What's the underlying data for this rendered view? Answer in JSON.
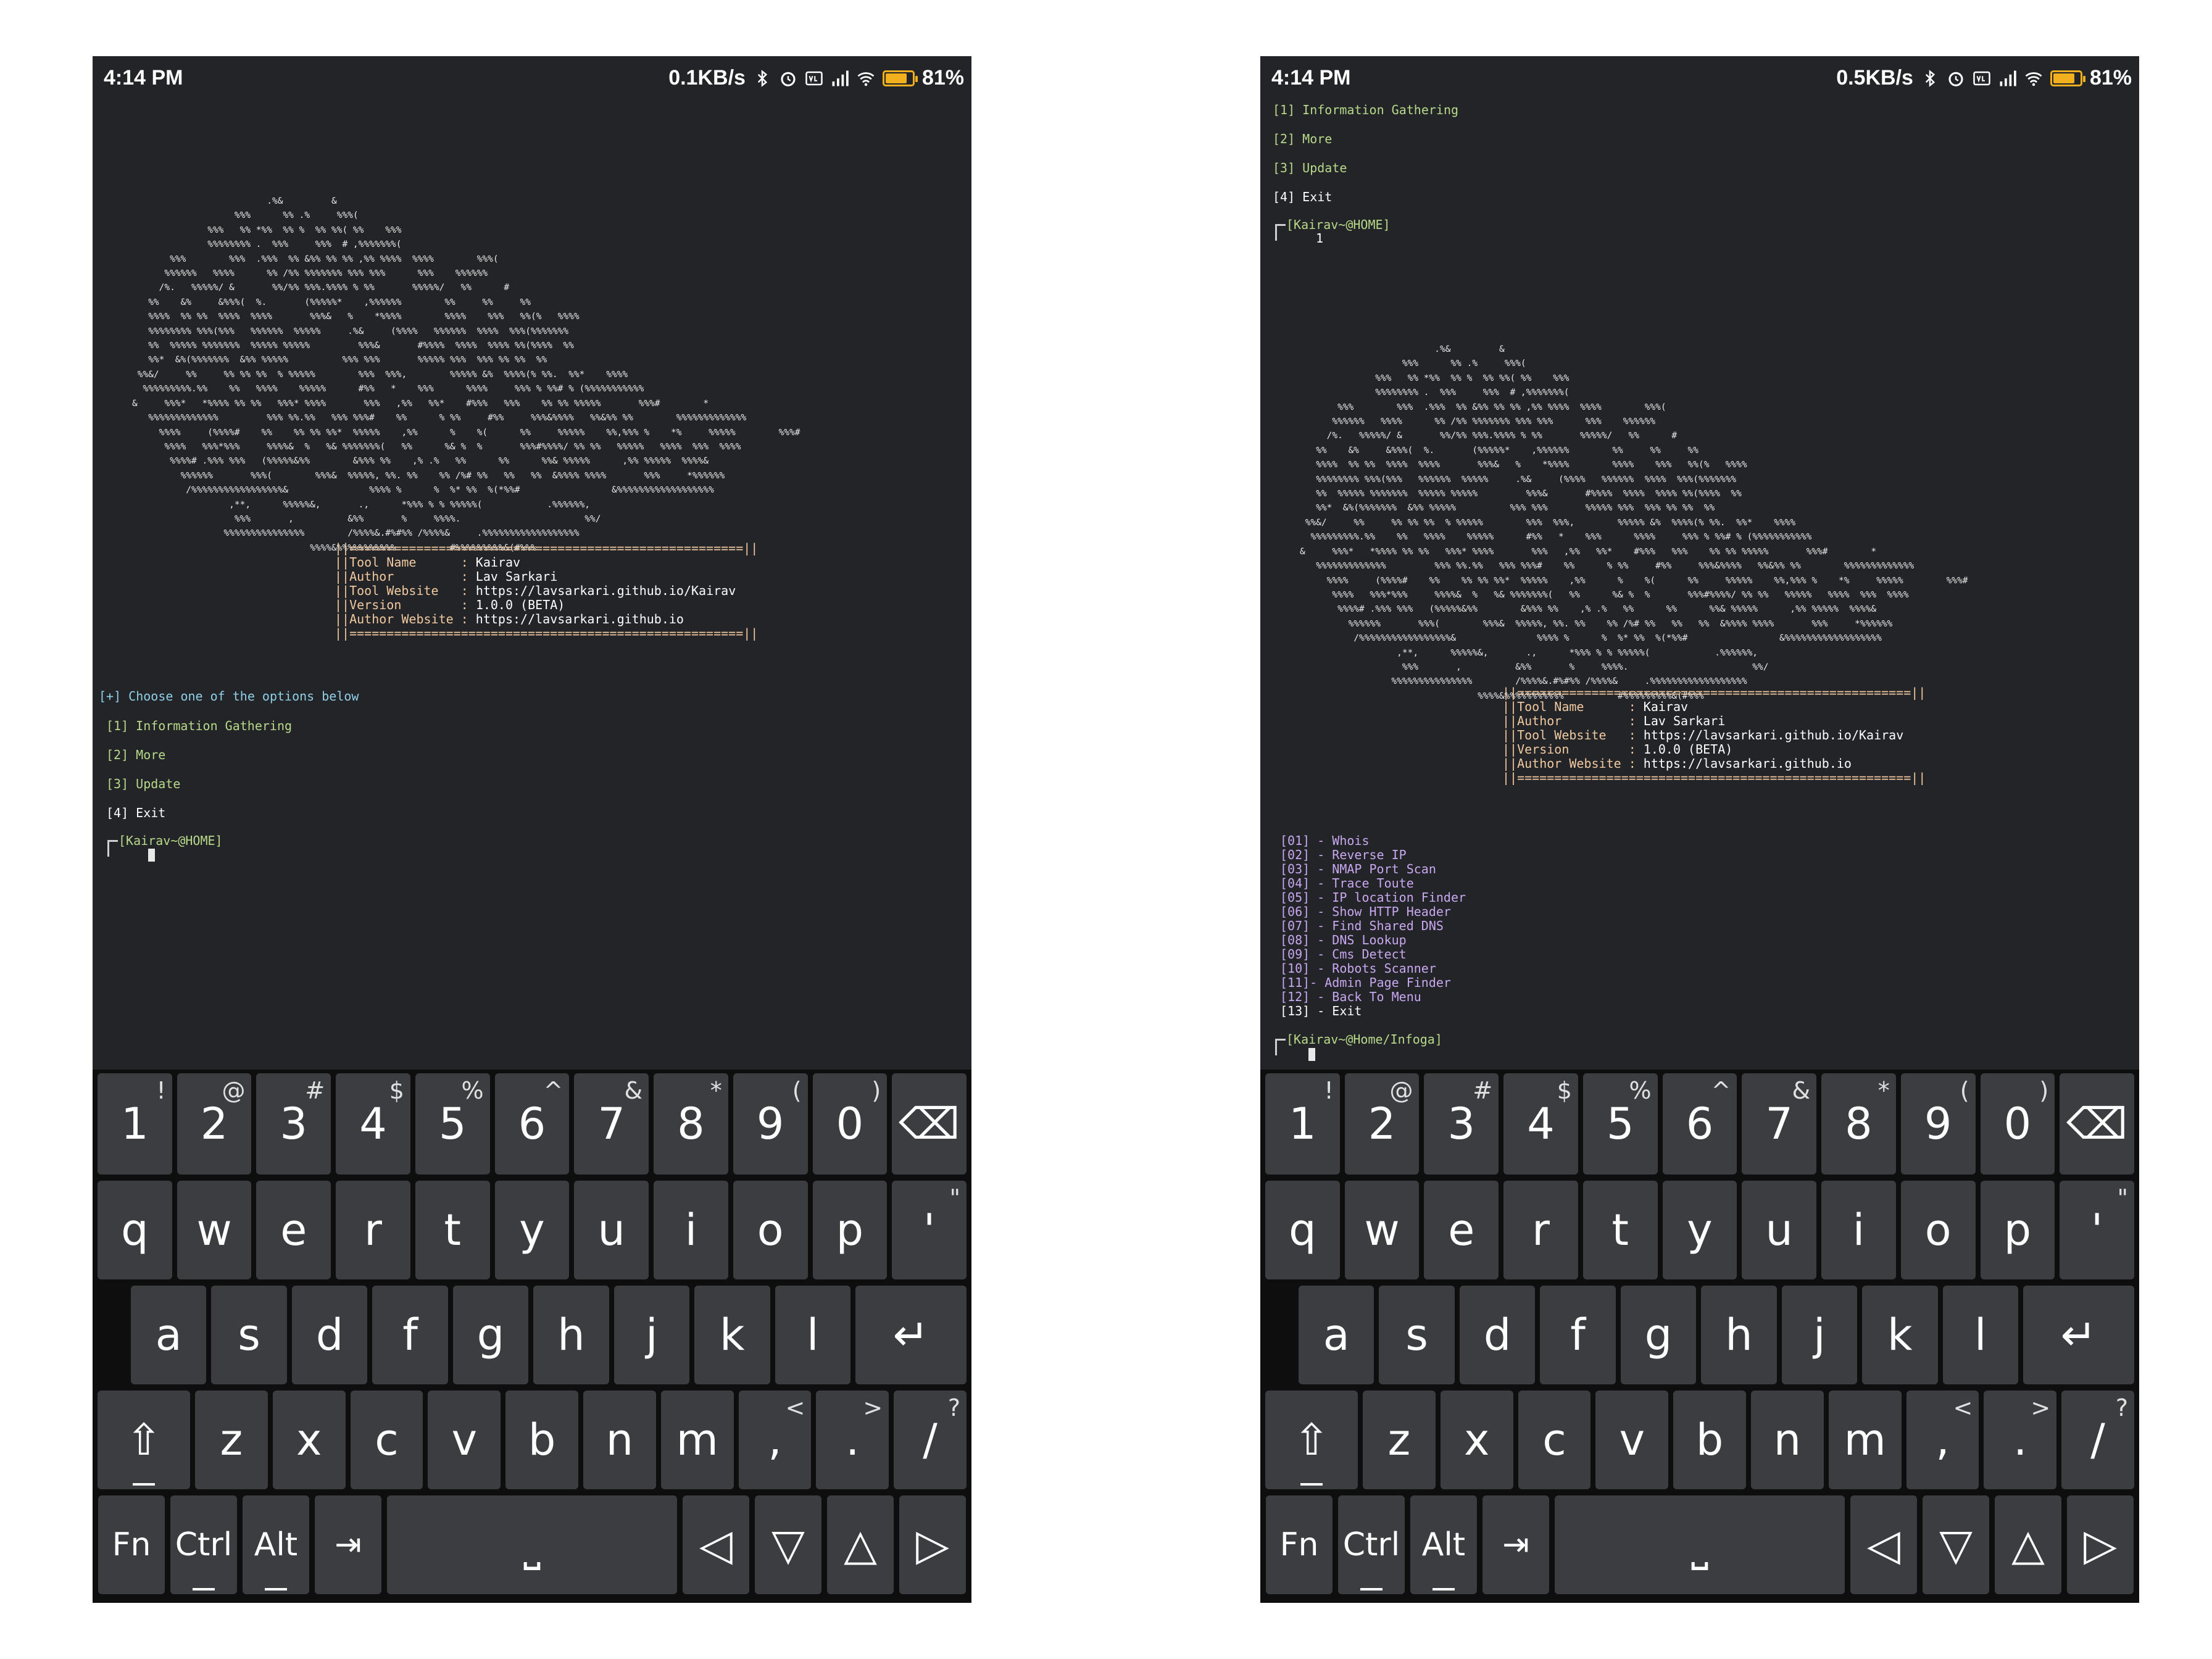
{
  "status_left": {
    "time": "4:14 PM",
    "network_speed": "0.1KB/s",
    "battery": "81%",
    "battery_level": 0.81
  },
  "status_right": {
    "time": "4:14 PM",
    "network_speed": "0.5KB/s",
    "battery": "81%",
    "battery_level": 0.81
  },
  "status_icons": [
    "bluetooth-icon",
    "alarm-icon",
    "volte-icon",
    "signal-icon",
    "wifi-icon",
    "battery-icon"
  ],
  "ascii_banner": "                         .%&         &\n                   %%%      %% .%     %%%(\n              %%%   %% *%%  %% %  %% %%( %%    %%%\n              %%%%%%%% .  %%%     %%%  # ,%%%%%%%(\n       %%%        %%%  .%%%  %% &%% %% %% ,%% %%%%  %%%%        %%%(\n      %%%%%%   %%%%      %% /%% %%%%%%% %%% %%%      %%%    %%%%%%\n     /%.   %%%%%/ &       %%/%% %%%.%%%% % %%       %%%%%/   %%      #\n   %%    &%     &%%%(  %.       (%%%%%*    ,%%%%%%        %%     %%     %%\n   %%%%  %% %%  %%%%  %%%%       %%%&   %    *%%%%        %%%%    %%%   %%(%   %%%%\n   %%%%%%%% %%%(%%%   %%%%%%  %%%%%     .%&     (%%%%   %%%%%%  %%%%  %%%(%%%%%%%\n   %%  %%%%% %%%%%%%  %%%%% %%%%%         %%%&       #%%%%  %%%%  %%%% %%(%%%%  %%\n   %%*  &%(%%%%%%%  &%% %%%%%          %%% %%%       %%%%% %%%  %%% %% %%  %%\n %%&/     %%     %% %% %%  % %%%%%        %%%  %%%,        %%%%% &%  %%%%(% %%.  %%*    %%%%\n  %%%%%%%%%.%%    %%   %%%%    %%%%%      #%%   *    %%%      %%%%     %%% % %%# % (%%%%%%%%%%%\n&     %%%*   *%%%% %% %%   %%%* %%%%       %%%   ,%%   %%*    #%%%   %%%    %% %% %%%%%       %%%#        *\n   %%%%%%%%%%%%%         %%% %%.%%   %%% %%%#    %%      % %%     #%%     %%%&%%%%   %%&%% %%        %%%%%%%%%%%%%\n     %%%%     (%%%%#    %%    %% %% %%*  %%%%%    ,%%      %    %(      %%     %%%%%    %%,%%% %    *%     %%%%%        %%%#\n      %%%%   %%%*%%%     %%%%&  %   %& %%%%%%%(   %%      %& %  %       %%%#%%%%/ %% %%   %%%%%   %%%%  %%%  %%%%\n       %%%%# .%%% %%%   (%%%%%&%%        &%%% %%    ,% .%   %%      %%      %%& %%%%%      ,%% %%%%%  %%%%&\n         %%%%%%       %%%(        %%%&  %%%%%, %%. %%    %% /%# %%   %%   %%  &%%%% %%%%       %%%     *%%%%%%\n          /%%%%%%%%%%%%%%%%%&               %%%% %      %  %* %%  %(*%%#                 &%%%%%%%%%%%%%%%%%%\n                  ,**,      %%%%%&,       .,      *%%% % % %%%%%(            .%%%%%%,\n                   %%%       ,          &%%       %     %%%%.                       %%/\n                 %%%%%%%%%%%%%%%        /%%%%&.#%#%% /%%%%&     .%%%%%%%%%%%%%%%%%%\n                                 %%%%&%%%%%%%%%%%          #%%%%%%%%%&(#%%%",
  "info_box": {
    "border": "||=====================================================||",
    "fields": [
      {
        "label": "Tool Name",
        "value": "Kairav"
      },
      {
        "label": "Author",
        "value": "Lav Sarkari"
      },
      {
        "label": "Tool Website",
        "value": "https://lavsarkari.github.io/Kairav"
      },
      {
        "label": "Version",
        "value": "1.0.0 (BETA)"
      },
      {
        "label": "Author Website",
        "value": "https://lavsarkari.github.io"
      }
    ]
  },
  "left_terminal": {
    "choose_prompt": "[+] Choose one of the options below",
    "options": [
      "[1] Information Gathering",
      "[2] More",
      "[3] Update",
      "[4] Exit"
    ],
    "prompt_label": "[Kairav~@HOME]"
  },
  "right_terminal": {
    "options": [
      "[1] Information Gathering",
      "[2] More",
      "[3] Update",
      "[4] Exit"
    ],
    "prompt_label": "[Kairav~@HOME]",
    "typed_input": "1",
    "menu_items": [
      "[01] - Whois",
      "[02] - Reverse IP",
      "[03] - NMAP Port Scan",
      "[04] - Trace Toute",
      "[05] - IP location Finder",
      "[06] - Show HTTP Header",
      "[07] - Find Shared DNS",
      "[08] - DNS Lookup",
      "[09] - Cms Detect",
      "[10] - Robots Scanner",
      "[11]- Admin Page Finder",
      "[12] - Back To Menu",
      "[13] - Exit"
    ],
    "prompt_label_2": "[Kairav~@Home/Infoga]"
  },
  "keyboard": {
    "row1": [
      {
        "main": "1",
        "sub": "!"
      },
      {
        "main": "2",
        "sub": "@"
      },
      {
        "main": "3",
        "sub": "#"
      },
      {
        "main": "4",
        "sub": "$"
      },
      {
        "main": "5",
        "sub": "%"
      },
      {
        "main": "6",
        "sub": "^"
      },
      {
        "main": "7",
        "sub": "&"
      },
      {
        "main": "8",
        "sub": "*"
      },
      {
        "main": "9",
        "sub": "("
      },
      {
        "main": "0",
        "sub": ")"
      },
      {
        "main": "⌫",
        "sub": ""
      }
    ],
    "row2": [
      {
        "main": "q",
        "sub": ""
      },
      {
        "main": "w",
        "sub": ""
      },
      {
        "main": "e",
        "sub": ""
      },
      {
        "main": "r",
        "sub": ""
      },
      {
        "main": "t",
        "sub": ""
      },
      {
        "main": "y",
        "sub": ""
      },
      {
        "main": "u",
        "sub": ""
      },
      {
        "main": "i",
        "sub": ""
      },
      {
        "main": "o",
        "sub": ""
      },
      {
        "main": "p",
        "sub": ""
      },
      {
        "main": "'",
        "sub": "\""
      }
    ],
    "row3": [
      {
        "main": "a",
        "sub": ""
      },
      {
        "main": "s",
        "sub": ""
      },
      {
        "main": "d",
        "sub": ""
      },
      {
        "main": "f",
        "sub": ""
      },
      {
        "main": "g",
        "sub": ""
      },
      {
        "main": "h",
        "sub": ""
      },
      {
        "main": "j",
        "sub": ""
      },
      {
        "main": "k",
        "sub": ""
      },
      {
        "main": "l",
        "sub": ""
      },
      {
        "main": "↵",
        "sub": ""
      }
    ],
    "row4": [
      {
        "main": "⇧",
        "sub": ""
      },
      {
        "main": "z",
        "sub": ""
      },
      {
        "main": "x",
        "sub": ""
      },
      {
        "main": "c",
        "sub": ""
      },
      {
        "main": "v",
        "sub": ""
      },
      {
        "main": "b",
        "sub": ""
      },
      {
        "main": "n",
        "sub": ""
      },
      {
        "main": "m",
        "sub": ""
      },
      {
        "main": ",",
        "sub": "<"
      },
      {
        "main": ".",
        "sub": ">"
      },
      {
        "main": "/",
        "sub": "?"
      }
    ],
    "row5": [
      {
        "main": "Fn",
        "sub": ""
      },
      {
        "main": "Ctrl",
        "sub": ""
      },
      {
        "main": "Alt",
        "sub": ""
      },
      {
        "main": "⇥",
        "sub": ""
      },
      {
        "main": "␣",
        "sub": ""
      },
      {
        "main": "◁",
        "sub": ""
      },
      {
        "main": "▽",
        "sub": ""
      },
      {
        "main": "△",
        "sub": ""
      },
      {
        "main": "▷",
        "sub": ""
      }
    ]
  }
}
